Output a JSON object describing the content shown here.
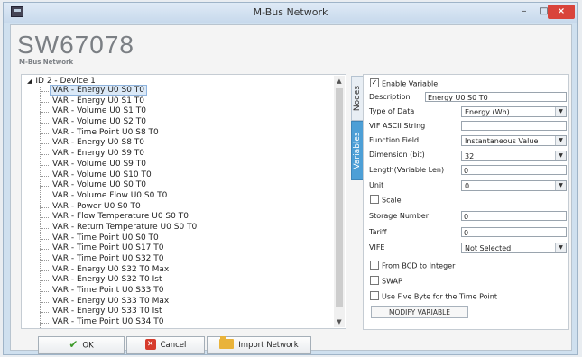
{
  "window": {
    "title": "M-Bus Network",
    "buttons": {
      "minimize": "–",
      "maximize": "□",
      "close": "×"
    }
  },
  "header": {
    "logo": "SW67078",
    "subtitle": "M-Bus Network"
  },
  "tree": {
    "root_label": "ID 2 - Device 1",
    "items": [
      "VAR - Energy U0 S0 T0",
      "VAR - Energy U0 S1 T0",
      "VAR - Volume U0 S1 T0",
      "VAR - Volume U0 S2 T0",
      "VAR - Time Point U0 S8 T0",
      "VAR - Energy U0 S8 T0",
      "VAR - Energy U0 S9 T0",
      "VAR - Volume U0 S9 T0",
      "VAR - Volume U0 S10 T0",
      "VAR - Volume U0 S0 T0",
      "VAR - Volume Flow U0 S0 T0",
      "VAR - Power U0 S0 T0",
      "VAR - Flow Temperature U0 S0 T0",
      "VAR - Return Temperature U0 S0 T0",
      "VAR - Time Point U0 S0 T0",
      "VAR - Time Point U0 S17 T0",
      "VAR - Time Point U0 S32 T0",
      "VAR - Energy U0 S32 T0 Max",
      "VAR - Energy U0 S32 T0 Ist",
      "VAR - Time Point U0 S33 T0",
      "VAR - Energy U0 S33 T0 Max",
      "VAR - Energy U0 S33 T0 Ist",
      "VAR - Time Point U0 S34 T0",
      "VAR - Energy U0 S34 T0 Max"
    ],
    "selected_index": 0
  },
  "tabs": {
    "nodes": "Nodes",
    "variables": "Variables"
  },
  "variable": {
    "enable_label": "Enable Variable",
    "description_label": "Description",
    "description_value": "Energy U0 S0 T0",
    "type_label": "Type of Data",
    "type_value": "Energy (Wh)",
    "vif_label": "VIF ASCII String",
    "vif_value": "",
    "function_label": "Function Field",
    "function_value": "Instantaneous Value",
    "dimension_label": "Dimension (bit)",
    "dimension_value": "32",
    "length_label": "Length(Variable Len)",
    "length_value": "0",
    "unit_label": "Unit",
    "unit_value": "0",
    "scale_label": "Scale",
    "storage_label": "Storage Number",
    "storage_value": "0",
    "tariff_label": "Tariff",
    "tariff_value": "0",
    "vife_label": "VIFE",
    "vife_value": "Not Selected",
    "bcd_label": "From BCD to Integer",
    "swap_label": "SWAP",
    "fivebyte_label": "Use Five Byte for the Time Point",
    "modify_label": "MODIFY VARIABLE"
  },
  "bottom": {
    "ok_label": "OK",
    "cancel_label": "Cancel",
    "import_label": "Import Network"
  }
}
